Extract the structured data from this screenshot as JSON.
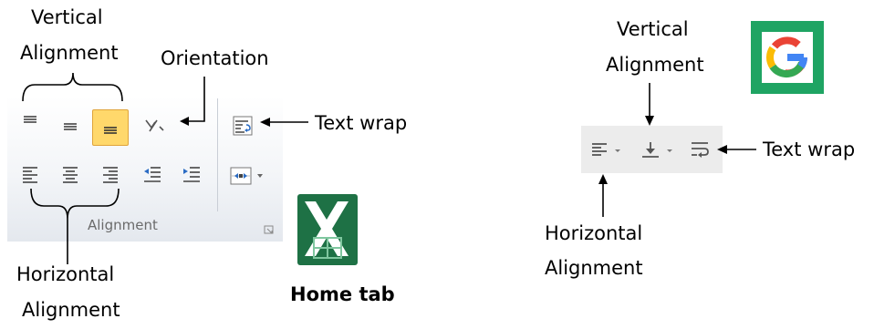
{
  "excel": {
    "labels": {
      "vertical_alignment_line1": "Vertical",
      "vertical_alignment_line2": "Alignment",
      "orientation": "Orientation",
      "text_wrap": "Text wrap",
      "horizontal_alignment_line1": "Horizontal",
      "horizontal_alignment_line2": "Alignment",
      "home_tab": "Home tab"
    },
    "ribbon": {
      "group_label": "Alignment",
      "row1_buttons": [
        "align-top-icon",
        "align-middle-icon",
        "align-bottom-icon",
        "orientation-icon"
      ],
      "row2_buttons": [
        "align-left-icon",
        "align-center-icon",
        "align-right-icon",
        "decrease-indent-icon",
        "increase-indent-icon"
      ],
      "right_buttons": [
        "wrap-text-icon",
        "merge-center-icon"
      ],
      "active_button": "align-bottom-icon",
      "active_color": "#ffd86b"
    },
    "logo": {
      "letter": "X",
      "color": "#1e7145"
    }
  },
  "sheets": {
    "labels": {
      "vertical_alignment_line1": "Vertical",
      "vertical_alignment_line2": "Alignment",
      "text_wrap": "Text wrap",
      "horizontal_alignment_line1": "Horizontal",
      "horizontal_alignment_line2": "Alignment"
    },
    "toolbar": {
      "buttons": [
        "horizontal-align-icon",
        "vertical-align-icon",
        "text-wrap-icon"
      ],
      "background": "#ececec"
    },
    "logo": {
      "color": "#1fa463"
    }
  }
}
